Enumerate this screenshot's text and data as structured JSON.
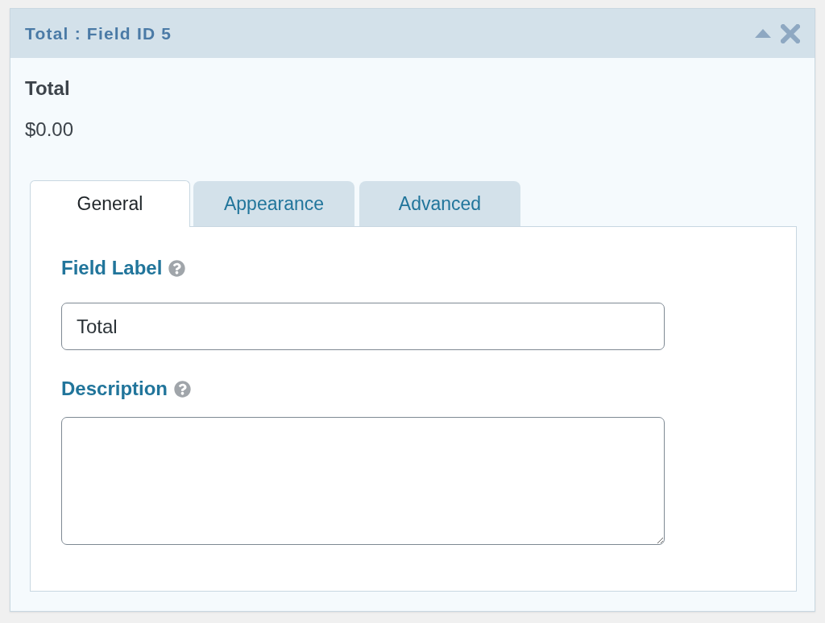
{
  "panel": {
    "title": "Total : Field ID 5"
  },
  "preview": {
    "label": "Total",
    "value": "$0.00"
  },
  "tabs": [
    {
      "label": "General",
      "selected": true
    },
    {
      "label": "Appearance",
      "selected": false
    },
    {
      "label": "Advanced",
      "selected": false
    }
  ],
  "settings": [
    {
      "kind": "text",
      "label": "Field Label",
      "value": "Total"
    },
    {
      "kind": "textarea",
      "label": "Description"
    }
  ]
}
